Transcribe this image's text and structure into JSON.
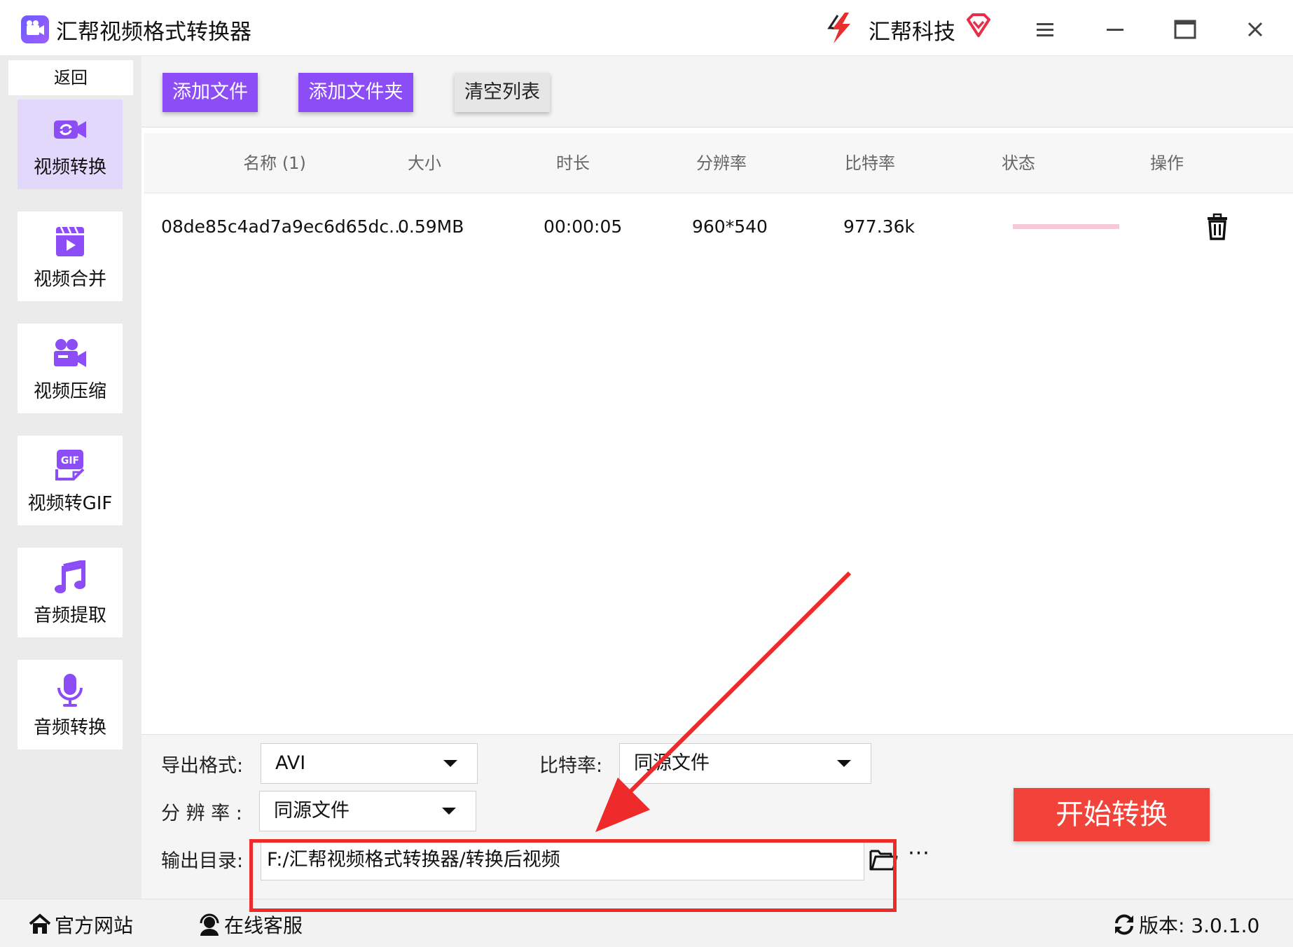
{
  "titlebar": {
    "app_title": "汇帮视频格式转换器",
    "brand_name": "汇帮科技"
  },
  "sidebar": {
    "back_label": "返回",
    "items": [
      {
        "label": "视频转换",
        "icon": "video-convert-icon"
      },
      {
        "label": "视频合并",
        "icon": "video-merge-icon"
      },
      {
        "label": "视频压缩",
        "icon": "video-compress-icon"
      },
      {
        "label": "视频转GIF",
        "icon": "gif-icon"
      },
      {
        "label": "音频提取",
        "icon": "music-note-icon"
      },
      {
        "label": "音频转换",
        "icon": "microphone-icon"
      }
    ]
  },
  "toolbar": {
    "add_file": "添加文件",
    "add_folder": "添加文件夹",
    "clear_list": "清空列表"
  },
  "table": {
    "columns": [
      "名称 (1)",
      "大小",
      "时长",
      "分辨率",
      "比特率",
      "状态",
      "操作"
    ],
    "rows": [
      {
        "name": "08de85c4ad7a9ec6d65dc...",
        "size": "0.59MB",
        "duration": "00:00:05",
        "resolution": "960*540",
        "bitrate": "977.36k"
      }
    ]
  },
  "settings": {
    "format_label": "导出格式:",
    "format_value": "AVI",
    "bitrate_label": "比特率:",
    "bitrate_value": "同源文件",
    "resolution_label": "分 辨 率 :",
    "resolution_value": "同源文件",
    "output_label": "输出目录:",
    "output_path": "F:/汇帮视频格式转换器/转换后视频",
    "more_label": "···",
    "start_button": "开始转换"
  },
  "footer": {
    "website": "官方网站",
    "support": "在线客服",
    "version": "版本: 3.0.1.0"
  },
  "colors": {
    "accent": "#8c4cf6",
    "start_button": "#f2433a",
    "annotation": "#ef2a2a",
    "sidebar_active": "#e1d8fb"
  }
}
